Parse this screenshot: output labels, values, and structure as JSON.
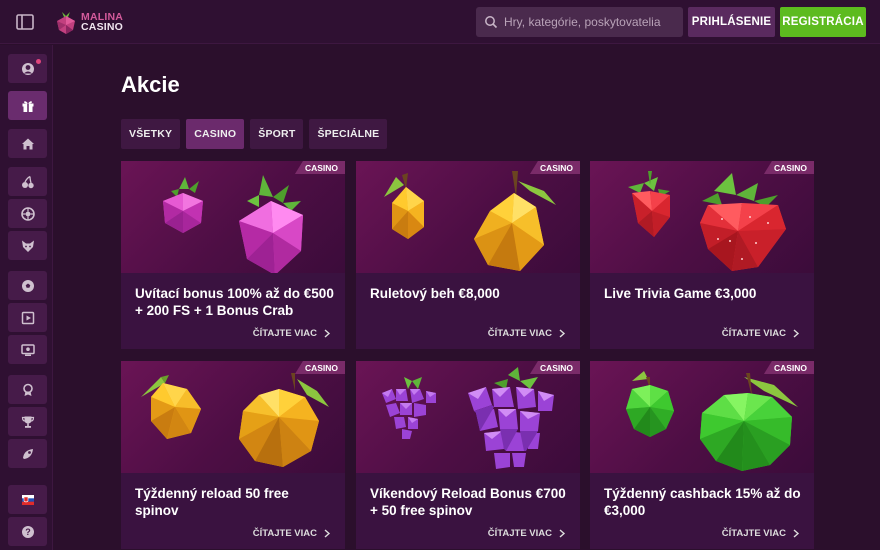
{
  "brand": {
    "line1": "MALINA",
    "line2": "CASINO"
  },
  "search": {
    "placeholder": "Hry, kategórie, poskytovatelia"
  },
  "header": {
    "login_label": "PRIHLÁSENIE",
    "register_label": "REGISTRÁCIA"
  },
  "page": {
    "title": "Akcie"
  },
  "tabs": [
    {
      "label": "VŠETKY",
      "active": false
    },
    {
      "label": "CASINO",
      "active": true
    },
    {
      "label": "ŠPORT",
      "active": false
    },
    {
      "label": "ŠPECIÁLNE",
      "active": false
    }
  ],
  "sidebar": {
    "items": [
      {
        "icon": "avatar-icon"
      },
      {
        "icon": "gift-icon",
        "active": true
      },
      {
        "icon": "home-icon"
      },
      {
        "icon": "cherry-icon"
      },
      {
        "icon": "roulette-icon"
      },
      {
        "icon": "fox-icon"
      },
      {
        "icon": "soccer-ball-icon"
      },
      {
        "icon": "play-square-icon"
      },
      {
        "icon": "live-tv-icon"
      },
      {
        "icon": "badge-icon"
      },
      {
        "icon": "trophy-icon"
      },
      {
        "icon": "rocket-icon"
      },
      {
        "icon": "slovak-flag-icon"
      },
      {
        "icon": "help-icon"
      }
    ]
  },
  "cards": [
    {
      "badge": "CASINO",
      "title": "Uvítací bonus 100% až do €500 + 200 FS + 1 Bonus Crab",
      "cta": "ČÍTAJTE VIAC",
      "fruit": "raspberry"
    },
    {
      "badge": "CASINO",
      "title": "Ruletový beh €8,000",
      "cta": "ČÍTAJTE VIAC",
      "fruit": "pear"
    },
    {
      "badge": "CASINO",
      "title": "Live Trivia Game €3,000",
      "cta": "ČÍTAJTE VIAC",
      "fruit": "strawberry"
    },
    {
      "badge": "CASINO",
      "title": "Týždenný reload 50 free spinov",
      "cta": "ČÍTAJTE VIAC",
      "fruit": "lemon"
    },
    {
      "badge": "CASINO",
      "title": "Víkendový Reload Bonus €700 + 50 free spinov",
      "cta": "ČÍTAJTE VIAC",
      "fruit": "grapes"
    },
    {
      "badge": "CASINO",
      "title": "Týždenný cashback 15% až do €3,000",
      "cta": "ČÍTAJTE VIAC",
      "fruit": "apple"
    }
  ],
  "colors": {
    "accent": "#6b2a6c",
    "register": "#5dbb1f",
    "background": "#2b0f2c"
  }
}
